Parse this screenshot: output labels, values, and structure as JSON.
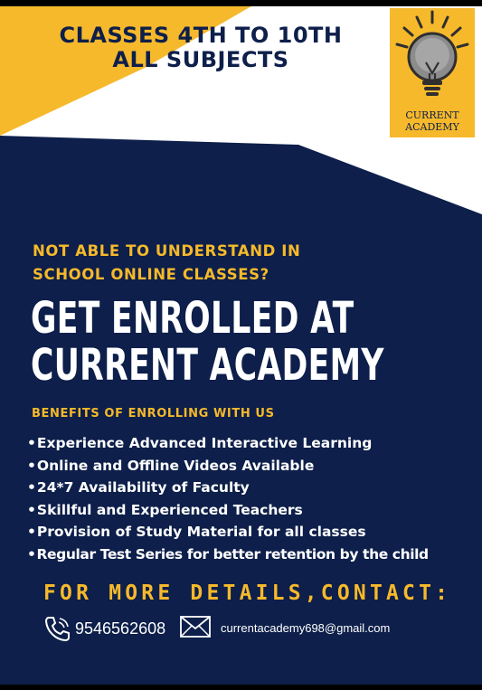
{
  "headline": {
    "line1": "CLASSES 4TH TO 10TH",
    "line2": "ALL SUBJECTS"
  },
  "logo": {
    "icon": "lightbulb-icon",
    "line1": "CURRENT",
    "line2": "ACADEMY"
  },
  "question": {
    "line1": "NOT ABLE TO UNDERSTAND IN",
    "line2": "SCHOOL ONLINE CLASSES?"
  },
  "cta": {
    "line1": "GET ENROLLED AT",
    "line2": "CURRENT ACADEMY"
  },
  "benefits_title": "BENEFITS OF ENROLLING WITH US",
  "benefits": [
    "Experience Advanced Interactive Learning",
    "Online and Offline Videos Available",
    "24*7 Availability of Faculty",
    "Skillful and Experienced Teachers",
    "Provision of Study Material for all classes",
    "Regular Test Series for better retention by the child"
  ],
  "contact": {
    "heading": "FOR MORE DETAILS,CONTACT:",
    "phone_icon": "phone-icon",
    "phone": "9546562608",
    "email_icon": "envelope-icon",
    "email": "currentacademy698@gmail.com"
  },
  "colors": {
    "navy": "#0d1f4a",
    "gold": "#f6b92b",
    "white": "#ffffff"
  }
}
